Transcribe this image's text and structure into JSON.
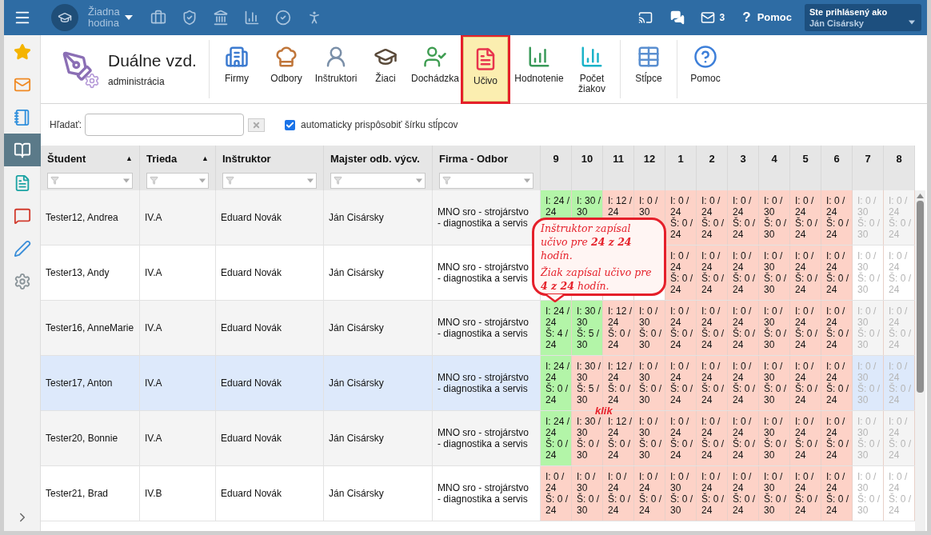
{
  "top_bar": {
    "menu": "Žiadna hodina",
    "mail_count": "3",
    "help_glyph": "?",
    "help": "Pomoc",
    "user_caption": "Ste prihlásený ako",
    "user_name": "Ján Cisársky"
  },
  "sidebar": {
    "items": [
      {
        "kind": "star",
        "selected": false
      },
      {
        "kind": "mail",
        "selected": false
      },
      {
        "kind": "notebook",
        "selected": false
      },
      {
        "kind": "book",
        "selected": true
      },
      {
        "kind": "file",
        "selected": false
      },
      {
        "kind": "chat",
        "selected": false
      },
      {
        "kind": "pen",
        "selected": false
      },
      {
        "kind": "gear",
        "selected": false
      }
    ]
  },
  "module": {
    "title": "Duálne vzd.",
    "subtitle": "administrácia"
  },
  "toolbar": [
    {
      "kind": "building",
      "label": "Firmy",
      "selected": false
    },
    {
      "kind": "chef",
      "label": "Odbory",
      "selected": false
    },
    {
      "kind": "instructor",
      "label": "Inštruktori",
      "selected": false
    },
    {
      "kind": "students",
      "label": "Žiaci",
      "selected": false
    },
    {
      "kind": "attendance",
      "label": "Dochádzka",
      "selected": false
    },
    {
      "kind": "curriculum",
      "label": "Učivo",
      "selected": true
    },
    {
      "kind": "grading",
      "label": "Hodnotenie",
      "selected": false
    },
    {
      "kind": "count",
      "label": "Počet žiakov",
      "selected": false
    },
    {
      "kind": "columns",
      "label": "Stĺpce",
      "selected": false
    },
    {
      "kind": "help",
      "label": "Pomoc",
      "selected": false
    }
  ],
  "search": {
    "label": "Hľadať:",
    "auto_width": {
      "label": "automaticky prispôsobiť šírku stĺpcov",
      "checked": true
    }
  },
  "table": {
    "columns": [
      {
        "label": "Študent",
        "sort_mark": "▲"
      },
      {
        "label": "Trieda",
        "sort_mark": "▲"
      },
      {
        "label": "Inštruktor"
      },
      {
        "label": "Majster odb. výcv."
      },
      {
        "label": "Firma - Odbor"
      }
    ],
    "months": [
      "9",
      "10",
      "11",
      "12",
      "1",
      "2",
      "3",
      "4",
      "5",
      "6",
      "7",
      "8"
    ],
    "rows": [
      {
        "student": "Tester12, Andrea",
        "class": "IV.A",
        "instructor": "Eduard Novák",
        "master": "Ján Cisársky",
        "company": "MNO sro - strojárstvo - diagnostika a servis",
        "selected": false,
        "cells": [
          {
            "i": "I: 24 / 24",
            "complete": true,
            "active": true
          },
          {
            "i": "I: 30 / 30",
            "complete": true,
            "active": true
          },
          {
            "i": "I: 12 / 24",
            "complete": false,
            "active": true
          },
          {
            "i": "I: 0 / 30",
            "complete": false,
            "active": true
          },
          {
            "i": "I: 0 / 24",
            "s": "Š: 0 / 24",
            "complete": false,
            "active": true
          },
          {
            "i": "I: 0 / 24",
            "s": "Š: 0 / 24",
            "complete": false,
            "active": true
          },
          {
            "i": "I: 0 / 24",
            "s": "Š: 0 / 24",
            "complete": false,
            "active": true
          },
          {
            "i": "I: 0 / 30",
            "s": "Š: 0 / 30",
            "complete": false,
            "active": true
          },
          {
            "i": "I: 0 / 24",
            "s": "Š: 0 / 24",
            "complete": false,
            "active": true
          },
          {
            "i": "I: 0 / 24",
            "s": "Š: 0 / 24",
            "complete": false,
            "active": true
          },
          {
            "i": "I: 0 / 30",
            "s": "Š: 0 / 30",
            "active": false
          },
          {
            "i": "I: 0 / 24",
            "s": "Š: 0 / 24",
            "active": false
          }
        ]
      },
      {
        "student": "Tester13, Andy",
        "class": "IV.A",
        "instructor": "Eduard Novák",
        "master": "Ján Cisársky",
        "company": "MNO sro - strojárstvo - diagnostika a servis",
        "selected": false,
        "cells": [
          {},
          {},
          {},
          {},
          {
            "i": "I: 0 / 24",
            "s": "Š: 0 / 24",
            "complete": false,
            "active": true
          },
          {
            "i": "I: 0 / 24",
            "s": "Š: 0 / 24",
            "complete": false,
            "active": true
          },
          {
            "i": "I: 0 / 24",
            "s": "Š: 0 / 24",
            "complete": false,
            "active": true
          },
          {
            "i": "I: 0 / 30",
            "s": "Š: 0 / 30",
            "complete": false,
            "active": true
          },
          {
            "i": "I: 0 / 24",
            "s": "Š: 0 / 24",
            "complete": false,
            "active": true
          },
          {
            "i": "I: 0 / 24",
            "s": "Š: 0 / 24",
            "complete": false,
            "active": true
          },
          {
            "i": "I: 0 / 30",
            "s": "Š: 0 / 30",
            "active": false
          },
          {
            "i": "I: 0 / 24",
            "s": "Š: 0 / 24",
            "active": false
          }
        ]
      },
      {
        "student": "Tester16, AnneMarie",
        "class": "IV.A",
        "instructor": "Eduard Novák",
        "master": "Ján Cisársky",
        "company": "MNO sro - strojárstvo - diagnostika a servis",
        "selected": false,
        "cells": [
          {
            "i": "I: 24 / 24",
            "s": "Š: 4 / 24",
            "complete": true,
            "active": true
          },
          {
            "i": "I: 30 / 30",
            "s": "Š: 5 / 30",
            "complete": true,
            "active": true
          },
          {
            "i": "I: 12 / 24",
            "s": "Š: 0 / 24",
            "complete": false,
            "active": true
          },
          {
            "i": "I: 0 / 30",
            "s": "Š: 0 / 30",
            "complete": false,
            "active": true
          },
          {
            "i": "I: 0 / 24",
            "s": "Š: 0 / 24",
            "complete": false,
            "active": true
          },
          {
            "i": "I: 0 / 24",
            "s": "Š: 0 / 24",
            "complete": false,
            "active": true
          },
          {
            "i": "I: 0 / 24",
            "s": "Š: 0 / 24",
            "complete": false,
            "active": true
          },
          {
            "i": "I: 0 / 30",
            "s": "Š: 0 / 30",
            "complete": false,
            "active": true
          },
          {
            "i": "I: 0 / 24",
            "s": "Š: 0 / 24",
            "complete": false,
            "active": true
          },
          {
            "i": "I: 0 / 24",
            "s": "Š: 0 / 24",
            "complete": false,
            "active": true
          },
          {
            "i": "I: 0 / 30",
            "s": "Š: 0 / 30",
            "active": false
          },
          {
            "i": "I: 0 / 24",
            "s": "Š: 0 / 24",
            "active": false
          }
        ]
      },
      {
        "student": "Tester17, Anton",
        "class": "IV.A",
        "instructor": "Eduard Novák",
        "master": "Ján Cisársky",
        "company": "MNO sro - strojárstvo - diagnostika a servis",
        "selected": true,
        "cells": [
          {
            "i": "I: 24 / 24",
            "s": "Š: 0 / 24",
            "complete": true,
            "active": true
          },
          {
            "i": "I: 30 / 30",
            "s": "Š: 5 / 30",
            "complete": false,
            "active": true
          },
          {
            "i": "I: 12 / 24",
            "s": "Š: 0 / 24",
            "complete": false,
            "active": true
          },
          {
            "i": "I: 0 / 30",
            "s": "Š: 0 / 30",
            "complete": false,
            "active": true
          },
          {
            "i": "I: 0 / 24",
            "s": "Š: 0 / 24",
            "complete": false,
            "active": true
          },
          {
            "i": "I: 0 / 24",
            "s": "Š: 0 / 24",
            "complete": false,
            "active": true
          },
          {
            "i": "I: 0 / 24",
            "s": "Š: 0 / 24",
            "complete": false,
            "active": true
          },
          {
            "i": "I: 0 / 30",
            "s": "Š: 0 / 30",
            "complete": false,
            "active": true
          },
          {
            "i": "I: 0 / 24",
            "s": "Š: 0 / 24",
            "complete": false,
            "active": true
          },
          {
            "i": "I: 0 / 24",
            "s": "Š: 0 / 24",
            "complete": false,
            "active": true
          },
          {
            "i": "I: 0 / 30",
            "s": "Š: 0 / 30",
            "active": false
          },
          {
            "i": "I: 0 / 24",
            "s": "Š: 0 / 24",
            "active": false
          }
        ]
      },
      {
        "student": "Tester20, Bonnie",
        "class": "IV.A",
        "instructor": "Eduard Novák",
        "master": "Ján Cisársky",
        "company": "MNO sro - strojárstvo - diagnostika a servis",
        "selected": false,
        "cells": [
          {
            "i": "I: 24 / 24",
            "s": "Š: 0 / 24",
            "complete": true,
            "active": true
          },
          {
            "i": "I: 30 / 30",
            "s": "Š: 0 / 30",
            "complete": false,
            "active": true
          },
          {
            "i": "I: 12 / 24",
            "s": "Š: 0 / 24",
            "complete": false,
            "active": true
          },
          {
            "i": "I: 0 / 30",
            "s": "Š: 0 / 30",
            "complete": false,
            "active": true
          },
          {
            "i": "I: 0 / 24",
            "s": "Š: 0 / 24",
            "complete": false,
            "active": true
          },
          {
            "i": "I: 0 / 24",
            "s": "Š: 0 / 24",
            "complete": false,
            "active": true
          },
          {
            "i": "I: 0 / 24",
            "s": "Š: 0 / 24",
            "complete": false,
            "active": true
          },
          {
            "i": "I: 0 / 30",
            "s": "Š: 0 / 30",
            "complete": false,
            "active": true
          },
          {
            "i": "I: 0 / 24",
            "s": "Š: 0 / 24",
            "complete": false,
            "active": true
          },
          {
            "i": "I: 0 / 24",
            "s": "Š: 0 / 24",
            "complete": false,
            "active": true
          },
          {
            "i": "I: 0 / 30",
            "s": "Š: 0 / 30",
            "active": false
          },
          {
            "i": "I: 0 / 24",
            "s": "Š: 0 / 24",
            "active": false
          }
        ]
      },
      {
        "student": "Tester21, Brad",
        "class": "IV.B",
        "instructor": "Eduard Novák",
        "master": "Ján Cisársky",
        "company": "MNO sro - strojárstvo - diagnostika a servis",
        "selected": false,
        "cells": [
          {
            "i": "I: 0 / 24",
            "s": "Š: 0 / 24",
            "complete": false,
            "active": true
          },
          {
            "i": "I: 0 / 30",
            "s": "Š: 0 / 30",
            "complete": false,
            "active": true
          },
          {
            "i": "I: 0 / 24",
            "s": "Š: 0 / 24",
            "complete": false,
            "active": true
          },
          {
            "i": "I: 0 / 24",
            "s": "Š: 0 / 24",
            "complete": false,
            "active": true
          },
          {
            "i": "I: 0 / 30",
            "s": "Š: 0 / 30",
            "complete": false,
            "active": true
          },
          {
            "i": "I: 0 / 24",
            "s": "Š: 0 / 24",
            "complete": false,
            "active": true
          },
          {
            "i": "I: 0 / 24",
            "s": "Š: 0 / 24",
            "complete": false,
            "active": true
          },
          {
            "i": "I: 0 / 30",
            "s": "Š: 0 / 30",
            "complete": false,
            "active": true
          },
          {
            "i": "I: 0 / 24",
            "s": "Š: 0 / 24",
            "complete": false,
            "active": true
          },
          {
            "i": "I: 0 / 24",
            "s": "Š: 0 / 24",
            "complete": false,
            "active": true
          },
          {
            "i": "I: 0 / 30",
            "s": "Š: 0 / 30",
            "active": false
          },
          {
            "i": "I: 0 / 24",
            "s": "Š: 0 / 24",
            "active": false
          }
        ]
      }
    ]
  },
  "annotations": {
    "callout": [
      "Inštruktor zapísal učivo pre **24 z 24** hodín.",
      "Žiak zapísal učivo pre **4 z 24** hodín."
    ],
    "click_label": "klik"
  }
}
